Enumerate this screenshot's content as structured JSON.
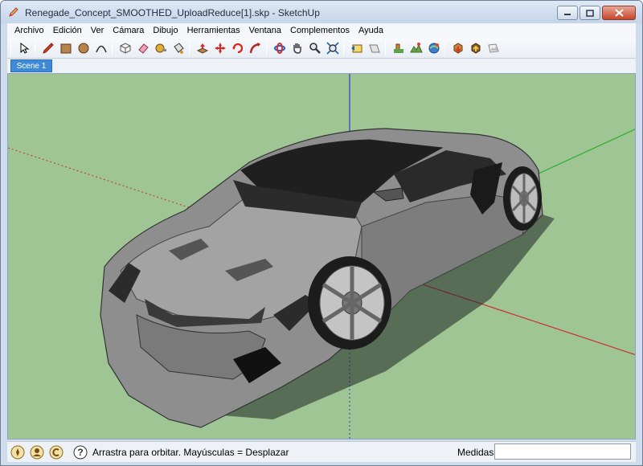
{
  "window": {
    "title": "Renegade_Concept_SMOOTHED_UploadReduce[1].skp - SketchUp",
    "app_icon": "sketchup-pencil-icon"
  },
  "menubar": {
    "items": [
      "Archivo",
      "Edición",
      "Ver",
      "Cámara",
      "Dibujo",
      "Herramientas",
      "Ventana",
      "Complementos",
      "Ayuda"
    ]
  },
  "toolbar": {
    "tools": [
      "select-arrow-icon",
      "pencil-line-icon",
      "rectangle-icon",
      "circle-icon",
      "arc-icon",
      "make-component-icon",
      "eraser-icon",
      "tape-measure-icon",
      "paint-bucket-icon",
      "push-pull-icon",
      "move-icon",
      "rotate-icon",
      "follow-me-icon",
      "orbit-icon",
      "pan-hand-icon",
      "zoom-icon",
      "zoom-extents-icon",
      "previous-view-icon",
      "next-view-icon",
      "add-location-icon",
      "toggle-terrain-icon",
      "get-models-icon",
      "share-model-icon",
      "share-component-icon",
      "photo-textures-icon"
    ]
  },
  "scenes": {
    "tabs": [
      "Scene 1"
    ]
  },
  "statusbar": {
    "hint": "Arrastra para orbitar. Mayúsculas = Desplazar",
    "measure_label": "Medidas",
    "measure_value": ""
  },
  "colors": {
    "sky_ground": "#a0c594",
    "axis_red": "#c83030",
    "axis_green": "#2fae2f",
    "axis_blue": "#2a3fd0",
    "car_body": "#8e8e8e",
    "scene_tab": "#3f8ad8"
  }
}
